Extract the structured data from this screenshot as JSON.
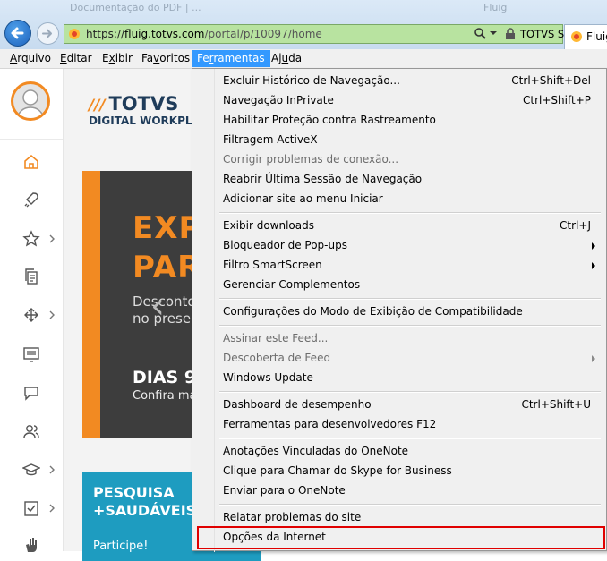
{
  "browser": {
    "ghost_tabs": [
      "Documentação do PDF | ...",
      "Fluig"
    ],
    "url_prefix": "https://",
    "url_host": "fluig.totvs.com",
    "url_path": "/portal/p/10097/home",
    "site_identity": "TOTVS SA [BR]",
    "tab_label": "Fluig"
  },
  "menubar": {
    "items": [
      {
        "pre": "",
        "key": "A",
        "post": "rquivo"
      },
      {
        "pre": "",
        "key": "E",
        "post": "ditar"
      },
      {
        "pre": "E",
        "key": "x",
        "post": "ibir"
      },
      {
        "pre": "Fa",
        "key": "v",
        "post": "oritos"
      },
      {
        "pre": "Fe",
        "key": "r",
        "post": "ramentas"
      },
      {
        "pre": "Aj",
        "key": "u",
        "post": "da"
      }
    ]
  },
  "page": {
    "brand_slashes": "///",
    "brand_name": "TOTVS",
    "brand_sub": "DIGITAL WORKPLACE",
    "banner_line1": "EXP",
    "banner_line2": "PAR",
    "banner_text1": "Desconto",
    "banner_text2": "no presen",
    "banner_days": "DIAS 9",
    "banner_confira": "Confira ma",
    "banner_prev": "‹",
    "card_line1": "PESQUISA",
    "card_line2": "+SAUDÁVEIS",
    "card_cta": "Participe!"
  },
  "sidebar": {
    "icons": [
      "home-icon",
      "rocket-icon",
      "star-icon",
      "documents-icon",
      "arrows-icon",
      "list-icon",
      "chat-icon",
      "people-icon",
      "graduation-cap-icon",
      "checklist-icon",
      "hand-icon"
    ]
  },
  "tools_menu": {
    "items": [
      {
        "label": "Excluir Histórico de Navegação...",
        "shortcut": "Ctrl+Shift+Del"
      },
      {
        "label": "Navegação InPrivate",
        "shortcut": "Ctrl+Shift+P"
      },
      {
        "label": "Habilitar Proteção contra Rastreamento",
        "shortcut": ""
      },
      {
        "label": "Filtragem ActiveX",
        "shortcut": ""
      },
      {
        "label": "Corrigir problemas de conexão...",
        "shortcut": ""
      },
      {
        "label": "Reabrir Última Sessão de Navegação",
        "shortcut": ""
      },
      {
        "label": "Adicionar site ao menu Iniciar",
        "shortcut": ""
      },
      {
        "label": "Exibir downloads",
        "shortcut": "Ctrl+J"
      },
      {
        "label": "Bloqueador de Pop-ups",
        "shortcut": ""
      },
      {
        "label": "Filtro SmartScreen",
        "shortcut": ""
      },
      {
        "label": "Gerenciar Complementos",
        "shortcut": ""
      },
      {
        "label": "Configurações do Modo de Exibição de Compatibilidade",
        "shortcut": ""
      },
      {
        "label": "Assinar este Feed...",
        "shortcut": ""
      },
      {
        "label": "Descoberta de Feed",
        "shortcut": ""
      },
      {
        "label": "Windows Update",
        "shortcut": ""
      },
      {
        "label": "Dashboard de desempenho",
        "shortcut": "Ctrl+Shift+U"
      },
      {
        "label": "Ferramentas para desenvolvedores F12",
        "shortcut": ""
      },
      {
        "label": "Anotações Vinculadas do OneNote",
        "shortcut": ""
      },
      {
        "label": "Clique para Chamar do Skype for Business",
        "shortcut": ""
      },
      {
        "label": "Enviar para o OneNote",
        "shortcut": ""
      },
      {
        "label": "Relatar problemas do site",
        "shortcut": ""
      },
      {
        "label": "Opções da Internet",
        "shortcut": ""
      }
    ]
  },
  "colors": {
    "accent_orange": "#f28a22",
    "menu_highlight": "#3399ff",
    "annotation_red": "#e00000",
    "address_bar_green": "#b8e3a0"
  }
}
